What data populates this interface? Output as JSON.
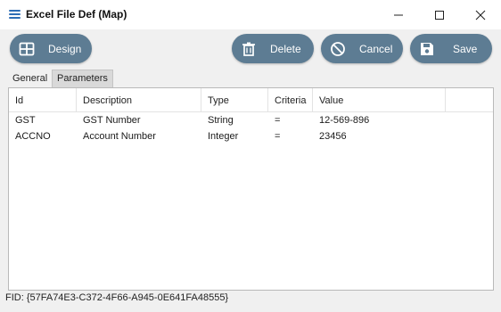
{
  "window": {
    "title": "Excel File Def (Map)",
    "icons": {
      "app": "list-icon",
      "minimize": "minimize-icon",
      "maximize": "maximize-icon",
      "close": "close-icon"
    }
  },
  "toolbar": {
    "design_label": "Design",
    "delete_label": "Delete",
    "cancel_label": "Cancel",
    "save_label": "Save",
    "button_color": "#5d7c93"
  },
  "tabs": [
    {
      "label": "General",
      "active": false
    },
    {
      "label": "Parameters",
      "active": true
    }
  ],
  "grid": {
    "columns": [
      "Id",
      "Description",
      "Type",
      "Criteria",
      "Value"
    ],
    "rows": [
      {
        "id": "GST",
        "description": "GST Number",
        "type": "String",
        "criteria": "=",
        "value": "12-569-896"
      },
      {
        "id": "ACCNO",
        "description": "Account Number",
        "type": "Integer",
        "criteria": "=",
        "value": "23456"
      }
    ]
  },
  "footer": {
    "fid": "FID: {57FA74E3-C372-4F66-A945-0E641FA48555}"
  }
}
